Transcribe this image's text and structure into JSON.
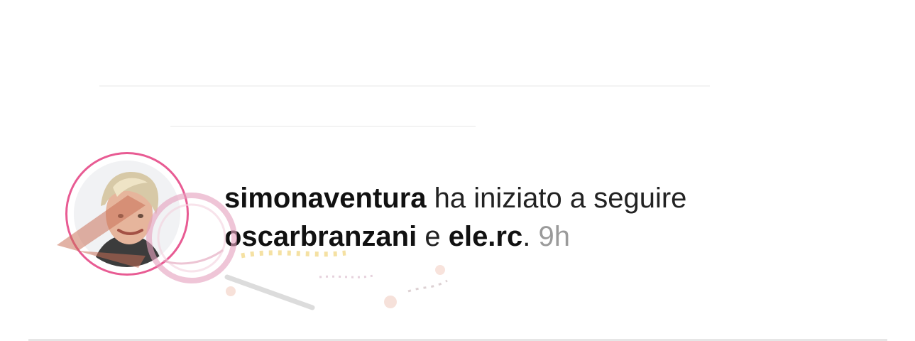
{
  "notification": {
    "actor": "simonaventura",
    "action_text": " ha iniziato a seguire",
    "target_1": "oscarbranzani",
    "connector": " e ",
    "target_2": "ele.rc",
    "period": ".",
    "time": "9h"
  },
  "icons": {
    "avatar": "profile-photo",
    "watermark": "decorative-watermark"
  },
  "colors": {
    "text": "#222222",
    "time": "#9a9a9a",
    "story_ring": "#e85b93"
  }
}
